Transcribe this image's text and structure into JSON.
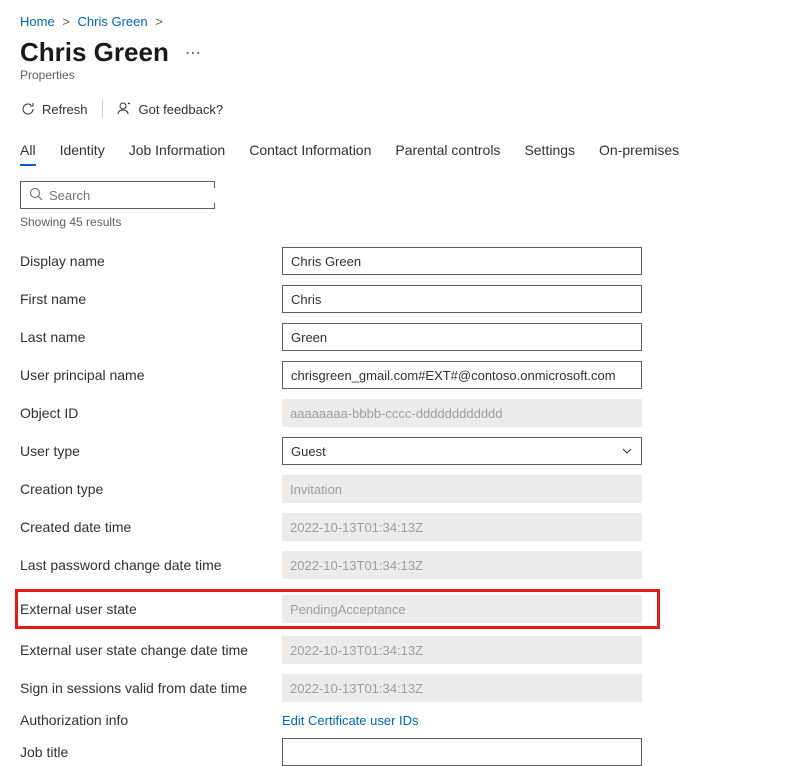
{
  "breadcrumb": {
    "home": "Home",
    "user": "Chris Green"
  },
  "header": {
    "title": "Chris Green",
    "subtitle": "Properties"
  },
  "commands": {
    "refresh": "Refresh",
    "feedback": "Got feedback?"
  },
  "tabs": {
    "all": "All",
    "identity": "Identity",
    "job": "Job Information",
    "contact": "Contact Information",
    "parental": "Parental controls",
    "settings": "Settings",
    "onprem": "On-premises"
  },
  "search": {
    "placeholder": "Search",
    "results": "Showing 45 results"
  },
  "props": {
    "display_name": {
      "label": "Display name",
      "value": "Chris Green"
    },
    "first_name": {
      "label": "First name",
      "value": "Chris"
    },
    "last_name": {
      "label": "Last name",
      "value": "Green"
    },
    "upn": {
      "label": "User principal name",
      "value": "chrisgreen_gmail.com#EXT#@contoso.onmicrosoft.com"
    },
    "object_id": {
      "label": "Object ID",
      "value": "aaaaaaaa-bbbb-cccc-dddddddddddd"
    },
    "user_type": {
      "label": "User type",
      "value": "Guest"
    },
    "creation_type": {
      "label": "Creation type",
      "value": "Invitation"
    },
    "created": {
      "label": "Created date time",
      "value": "2022-10-13T01:34:13Z"
    },
    "pwd_change": {
      "label": "Last password change date time",
      "value": "2022-10-13T01:34:13Z"
    },
    "ext_state": {
      "label": "External user state",
      "value": "PendingAcceptance"
    },
    "ext_state_change": {
      "label": "External user state change date time",
      "value": "2022-10-13T01:34:13Z"
    },
    "signin_valid": {
      "label": "Sign in sessions valid from date time",
      "value": "2022-10-13T01:34:13Z"
    },
    "auth_info": {
      "label": "Authorization info",
      "value": "Edit Certificate user IDs"
    },
    "job_title": {
      "label": "Job title",
      "value": ""
    }
  }
}
